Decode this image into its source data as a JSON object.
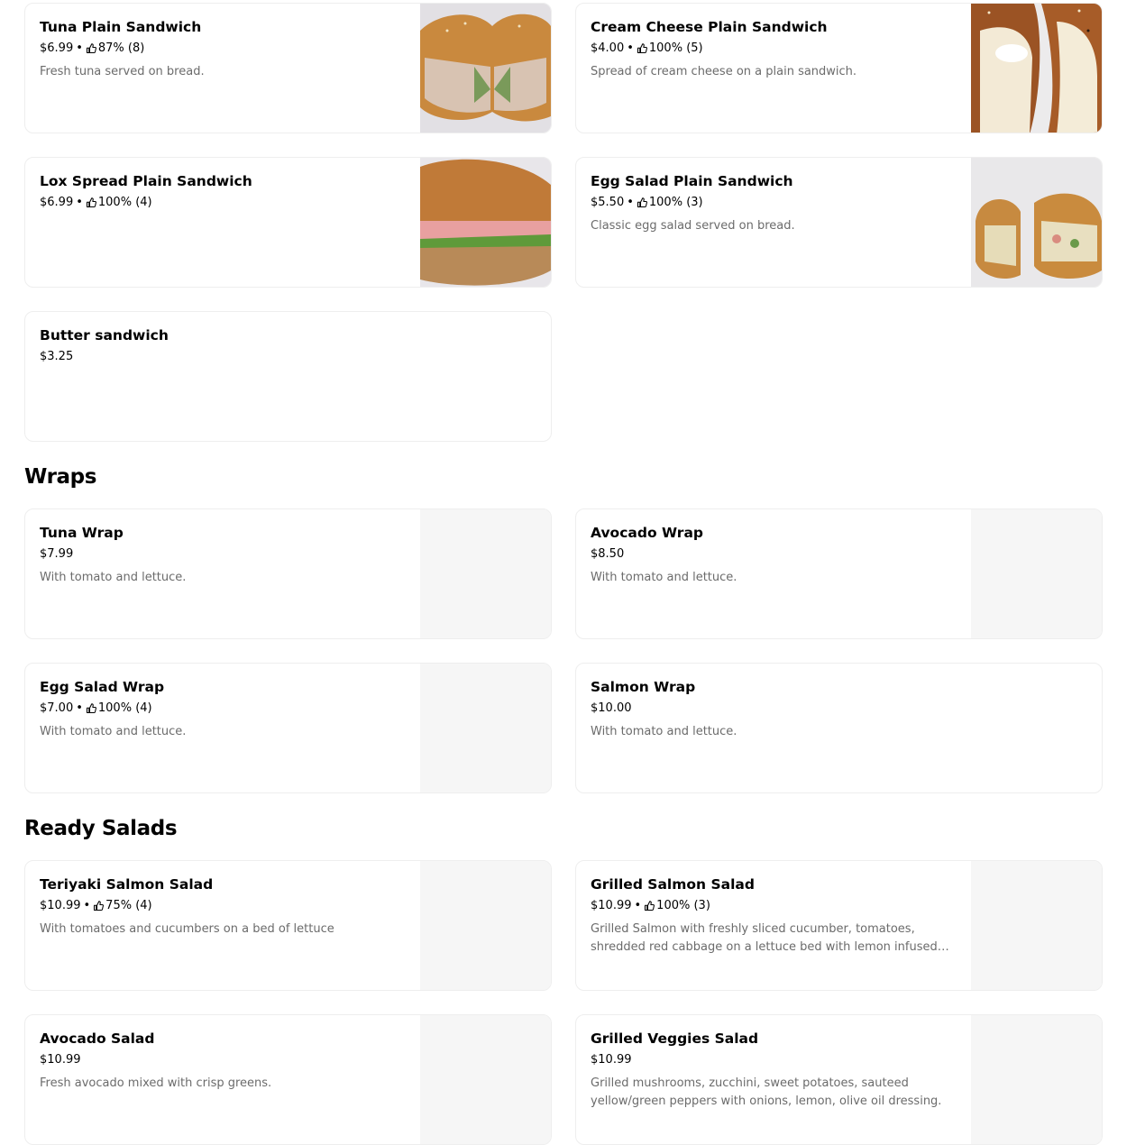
{
  "sections": {
    "sandwiches": {
      "items": [
        {
          "name": "Tuna Plain Sandwich",
          "price": "$6.99",
          "rating": "87% (8)",
          "desc": "Fresh tuna served on bread."
        },
        {
          "name": "Cream Cheese Plain Sandwich",
          "price": "$4.00",
          "rating": "100% (5)",
          "desc": "Spread of cream cheese on a plain sandwich."
        },
        {
          "name": "Lox Spread Plain Sandwich",
          "price": "$6.99",
          "rating": "100% (4)",
          "desc": ""
        },
        {
          "name": "Egg Salad Plain Sandwich",
          "price": "$5.50",
          "rating": "100% (3)",
          "desc": "Classic egg salad served on bread."
        },
        {
          "name": "Butter sandwich",
          "price": "$3.25",
          "rating": "",
          "desc": ""
        }
      ]
    },
    "wraps": {
      "title": "Wraps",
      "items": [
        {
          "name": "Tuna Wrap",
          "price": "$7.99",
          "rating": "",
          "desc": "With tomato and lettuce."
        },
        {
          "name": "Avocado Wrap",
          "price": "$8.50",
          "rating": "",
          "desc": "With tomato and lettuce."
        },
        {
          "name": "Egg Salad Wrap",
          "price": "$7.00",
          "rating": "100% (4)",
          "desc": "With tomato and lettuce."
        },
        {
          "name": "Salmon Wrap",
          "price": "$10.00",
          "rating": "",
          "desc": "With tomato and lettuce."
        }
      ]
    },
    "salads": {
      "title": "Ready Salads",
      "items": [
        {
          "name": "Teriyaki Salmon Salad",
          "price": "$10.99",
          "rating": "75% (4)",
          "desc": "With tomatoes and cucumbers on a bed of lettuce"
        },
        {
          "name": "Grilled Salmon Salad",
          "price": "$10.99",
          "rating": "100% (3)",
          "desc": "Grilled Salmon with freshly sliced cucumber, tomatoes, shredded red cabbage on a lettuce bed with lemon infused olive oil dressing."
        },
        {
          "name": "Avocado Salad",
          "price": "$10.99",
          "rating": "",
          "desc": "Fresh avocado mixed with crisp greens."
        },
        {
          "name": "Grilled Veggies Salad",
          "price": "$10.99",
          "rating": "",
          "desc": "Grilled mushrooms, zucchini, sweet potatoes, sauteed yellow/green peppers with onions, lemon, olive oil dressing."
        }
      ]
    }
  },
  "colors": {
    "muted_text": "#6b6b6b",
    "card_border": "#eeeeee",
    "image_placeholder": "#f6f6f6"
  },
  "icons": {
    "rating": "thumbs-up-icon"
  }
}
